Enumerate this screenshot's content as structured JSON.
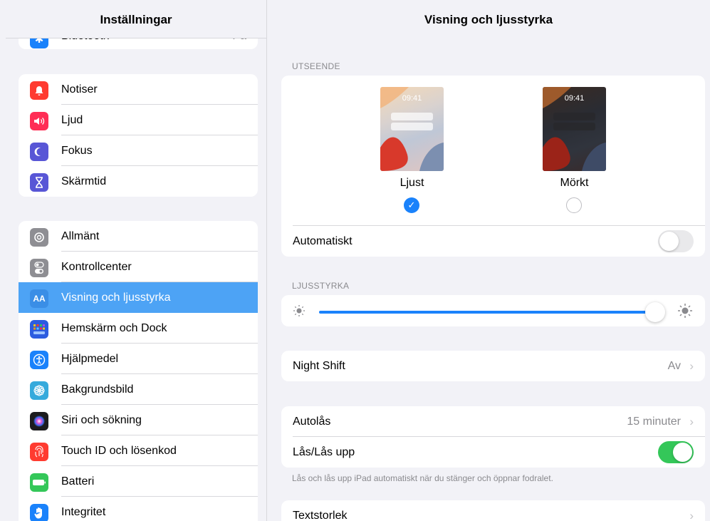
{
  "sidebar": {
    "title": "Inställningar",
    "partial_item": {
      "label": "Bluetooth",
      "value": "På"
    },
    "group1": [
      {
        "label": "Notiser",
        "icon": "bell-icon",
        "color": "#ff3b30"
      },
      {
        "label": "Ljud",
        "icon": "speaker-icon",
        "color": "#ff2d55"
      },
      {
        "label": "Fokus",
        "icon": "moon-icon",
        "color": "#5856d6"
      },
      {
        "label": "Skärmtid",
        "icon": "hourglass-icon",
        "color": "#5856d6"
      }
    ],
    "group2": [
      {
        "label": "Allmänt",
        "icon": "gear-icon",
        "color": "#8e8e93"
      },
      {
        "label": "Kontrollcenter",
        "icon": "switches-icon",
        "color": "#8e8e93"
      },
      {
        "label": "Visning och ljusstyrka",
        "icon": "text-size-icon",
        "color": "#3a8ee6",
        "selected": true
      },
      {
        "label": "Hemskärm och Dock",
        "icon": "grid-icon",
        "color": "#2c5ce0"
      },
      {
        "label": "Hjälpmedel",
        "icon": "accessibility-icon",
        "color": "#1a82fb"
      },
      {
        "label": "Bakgrundsbild",
        "icon": "flower-icon",
        "color": "#35aadc"
      },
      {
        "label": "Siri och sökning",
        "icon": "siri-icon",
        "color": "#1c1c1e"
      },
      {
        "label": "Touch ID och lösenkod",
        "icon": "fingerprint-icon",
        "color": "#ff3b30"
      },
      {
        "label": "Batteri",
        "icon": "battery-icon",
        "color": "#34c759"
      },
      {
        "label": "Integritet",
        "icon": "hand-icon",
        "color": "#1a82fb"
      }
    ]
  },
  "main": {
    "title": "Visning och ljusstyrka",
    "appearance": {
      "header": "UTSEENDE",
      "light": {
        "label": "Ljust",
        "time": "09:41",
        "selected": true
      },
      "dark": {
        "label": "Mörkt",
        "time": "09:41",
        "selected": false
      },
      "automatic_label": "Automatiskt",
      "automatic_on": false
    },
    "brightness": {
      "header": "LJUSSTYRKA",
      "level": 0.97
    },
    "night_shift": {
      "label": "Night Shift",
      "value": "Av"
    },
    "autolock": {
      "label": "Autolås",
      "value": "15 minuter"
    },
    "lock_unlock": {
      "label": "Lås/Lås upp",
      "on": true
    },
    "lock_footnote": "Lås och lås upp iPad automatiskt när du stänger och öppnar fodralet.",
    "text_size": {
      "label": "Textstorlek"
    }
  },
  "colors": {
    "accent": "#1a82fb",
    "selected_row": "#4da3f5",
    "toggle_on": "#34c759",
    "background": "#f2f2f7"
  }
}
